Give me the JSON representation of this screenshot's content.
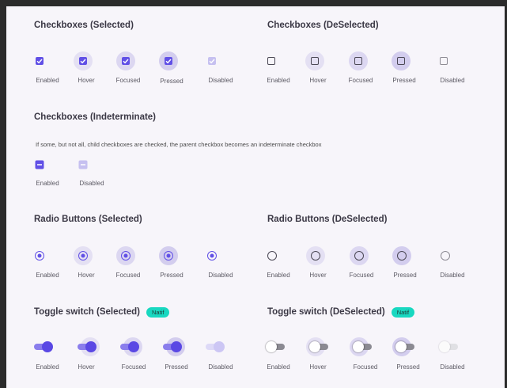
{
  "colors": {
    "primary": "#6150e6",
    "badge": "#18d8c0",
    "background": "#f7f5fa"
  },
  "state_labels": [
    "Enabled",
    "Hover",
    "Focused",
    "Pressed",
    "Disabled"
  ],
  "checkboxes_selected": {
    "title": "Checkboxes (Selected)"
  },
  "checkboxes_deselected": {
    "title": "Checkboxes (DeSelected)"
  },
  "checkboxes_indeterminate": {
    "title": "Checkboxes (Indeterminate)",
    "description": "If some, but not all, child checkboxes are checked, the parent checkbox becomes an indeterminate checkbox",
    "labels": [
      "Enabled",
      "Disabled"
    ]
  },
  "radio_selected": {
    "title": "Radio Buttons (Selected)"
  },
  "radio_deselected": {
    "title": "Radio Buttons (DeSelected)"
  },
  "toggle_selected": {
    "title": "Toggle switch (Selected)",
    "badge": "Natif"
  },
  "toggle_deselected": {
    "title": "Toggle switch (DeSelected)",
    "badge": "Natif"
  }
}
